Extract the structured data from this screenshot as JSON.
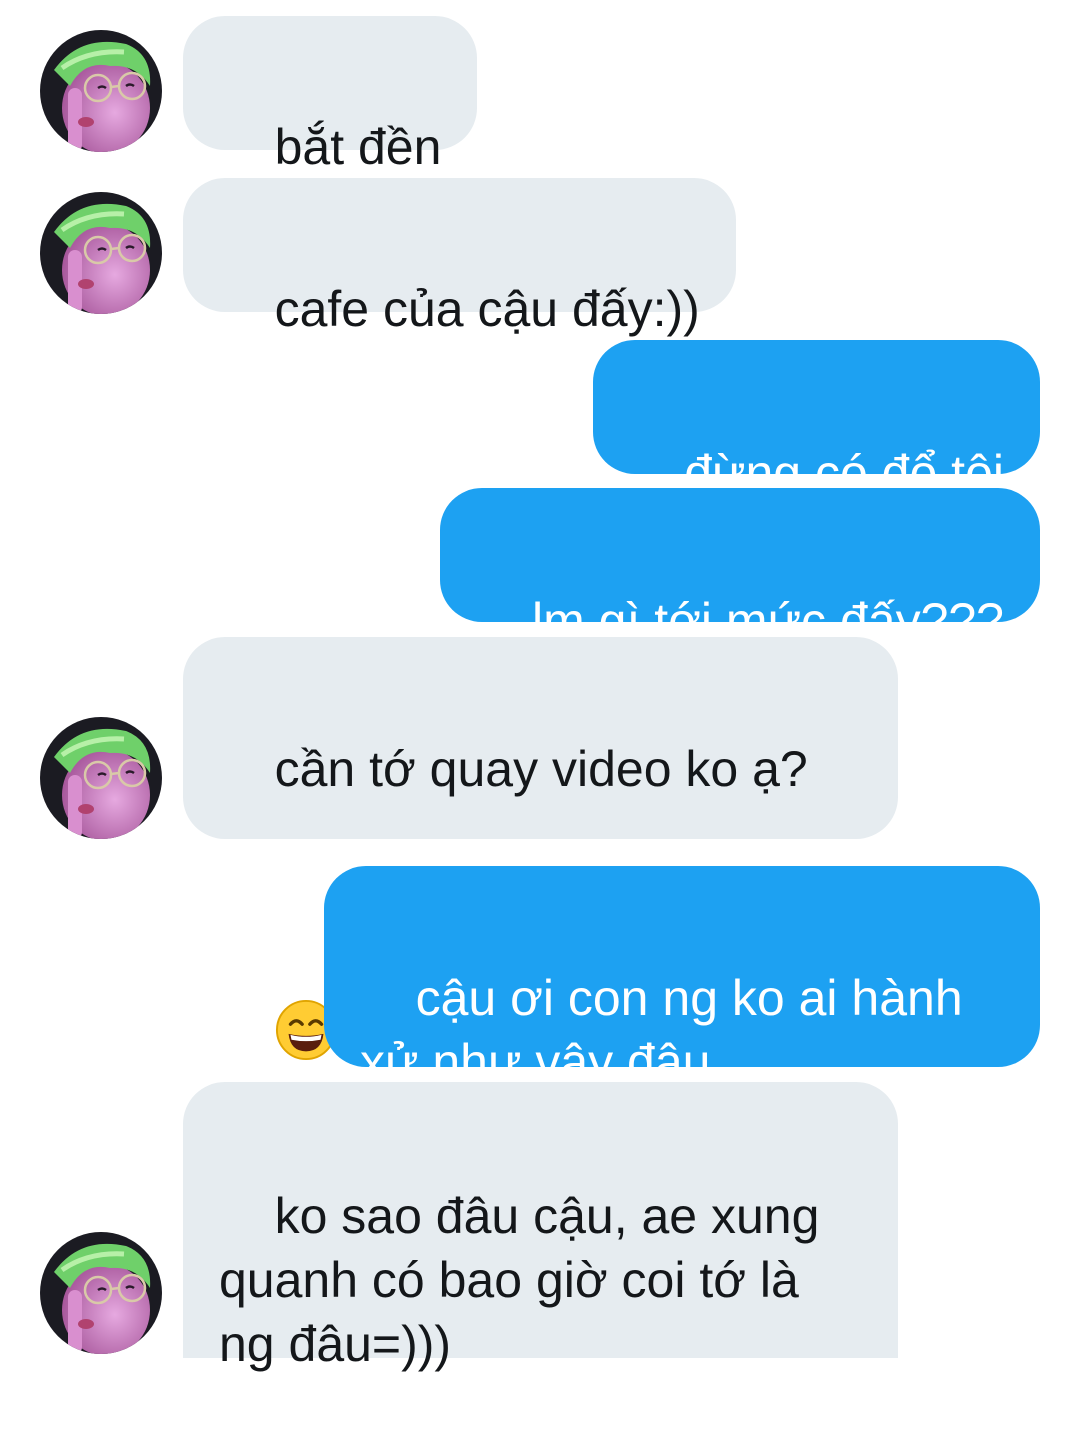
{
  "conversation": {
    "messages": [
      {
        "sender": "other",
        "text": "bắt đền",
        "avatar_icon": "contact-avatar-icon"
      },
      {
        "sender": "other",
        "text": "cafe của cậu đấy:))",
        "avatar_icon": "contact-avatar-icon"
      },
      {
        "sender": "me",
        "text": "đừng có đổ tội"
      },
      {
        "sender": "me",
        "text": "lm gì tới mức đấy???"
      },
      {
        "sender": "other",
        "text": "cần tớ quay video ko ạ?",
        "emoji": "grinning-face-emoji",
        "avatar_icon": "contact-avatar-icon"
      },
      {
        "sender": "me",
        "text": "cậu ơi con ng ko ai hành\nxử như vậy đâu"
      },
      {
        "sender": "other",
        "text": "ko sao đâu cậu, ae xung\nquanh có bao giờ coi tớ là\nng đâu=)))",
        "avatar_icon": "contact-avatar-icon"
      }
    ]
  },
  "colors": {
    "incoming_bubble": "#e6ecf0",
    "outgoing_bubble": "#1da1f2",
    "incoming_text": "#14171a",
    "outgoing_text": "#ffffff"
  }
}
